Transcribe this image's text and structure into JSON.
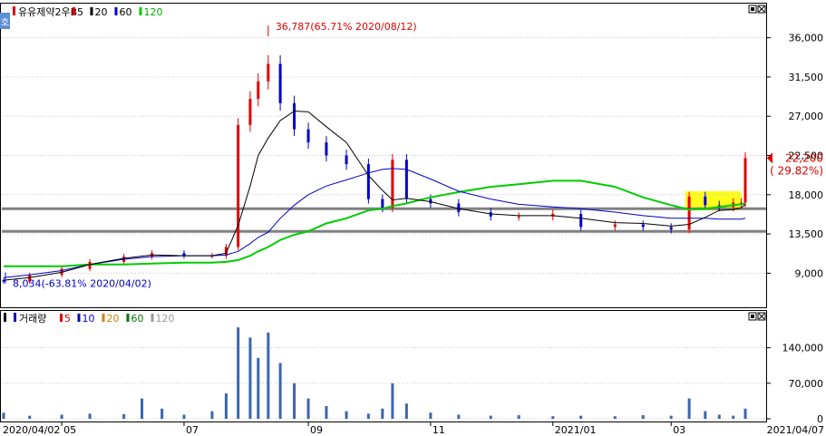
{
  "price_panel": {
    "legend_name": "유유제약2우B",
    "ma_labels": [
      "5",
      "20",
      "60",
      "120"
    ],
    "ma_colors": [
      "#e00000",
      "#000000",
      "#0000cc",
      "#00cc00"
    ],
    "side_tab": "호",
    "high_annotation": "36,787(65.71% 2020/08/12)",
    "low_annotation": "8,034(-63.81% 2020/04/02)",
    "last_price": "22,200",
    "last_change": "( 29.82%)"
  },
  "volume_panel": {
    "legend_name": "거래량",
    "ma_labels": [
      "5",
      "10",
      "20",
      "60",
      "120"
    ],
    "ma_colors": [
      "#e00000",
      "#0000cc",
      "#d08000",
      "#007700",
      "#999999"
    ]
  },
  "x_axis": {
    "start_label": "2020/04/02",
    "end_label": "2021/04/07",
    "ticks": [
      "05",
      "07",
      "09",
      "11",
      "2021/01",
      "03"
    ]
  },
  "colors": {
    "up": "#e00000",
    "down": "#0000cc",
    "highlight": "#ffff00",
    "support_line": "#808080"
  },
  "chart_data": [
    {
      "type": "line",
      "name": "price",
      "y_ticks": [
        9000,
        13500,
        18000,
        22500,
        27000,
        31500,
        36000
      ],
      "y_tick_labels": [
        "9,000",
        "13,500",
        "18,000",
        "22,500",
        "27,000",
        "31,500",
        "36,000"
      ],
      "ylim": [
        5400,
        39500
      ],
      "x": [
        "2020-04-02",
        "2020-04-15",
        "2020-05-01",
        "2020-05-15",
        "2020-06-01",
        "2020-06-15",
        "2020-07-01",
        "2020-07-15",
        "2020-07-22",
        "2020-07-28",
        "2020-08-03",
        "2020-08-07",
        "2020-08-12",
        "2020-08-18",
        "2020-08-25",
        "2020-09-01",
        "2020-09-10",
        "2020-09-20",
        "2020-10-01",
        "2020-10-08",
        "2020-10-13",
        "2020-10-20",
        "2020-11-01",
        "2020-11-15",
        "2020-12-01",
        "2020-12-15",
        "2021-01-01",
        "2021-01-15",
        "2021-02-01",
        "2021-02-15",
        "2021-03-01",
        "2021-03-10",
        "2021-03-18",
        "2021-03-25",
        "2021-04-01",
        "2021-04-05",
        "2021-04-07"
      ],
      "close": [
        8034,
        8800,
        9500,
        10300,
        10900,
        11300,
        11000,
        11000,
        12000,
        26000,
        29000,
        31000,
        33000,
        28500,
        25500,
        24000,
        22500,
        21500,
        17500,
        16500,
        22000,
        17500,
        17000,
        16000,
        15500,
        15500,
        15800,
        14300,
        14600,
        14300,
        14000,
        17800,
        16800,
        16600,
        17100,
        17100,
        22200
      ],
      "ma120": [
        9800,
        9800,
        9800,
        10000,
        10000,
        10100,
        10200,
        10200,
        10300,
        10500,
        11000,
        11500,
        12000,
        12800,
        13400,
        13800,
        14700,
        15300,
        16200,
        16400,
        16700,
        17000,
        17700,
        18300,
        18900,
        19200,
        19600,
        19600,
        18900,
        17700,
        16800,
        16300,
        16400,
        16600,
        16800,
        16900,
        17000
      ],
      "ma60": [
        8500,
        8800,
        9300,
        10000,
        10600,
        10900,
        11000,
        11000,
        11100,
        11500,
        12400,
        13100,
        13700,
        15300,
        16800,
        18000,
        19000,
        19700,
        20500,
        20900,
        21000,
        20900,
        19800,
        18400,
        17500,
        16900,
        16600,
        16400,
        16000,
        15600,
        15300,
        15300,
        15300,
        15200,
        15200,
        15200,
        15300
      ],
      "ma20": [
        8200,
        8500,
        9100,
        10000,
        10700,
        11100,
        11000,
        11000,
        11300,
        14500,
        19000,
        22500,
        24500,
        26500,
        27600,
        27500,
        25800,
        24000,
        20200,
        18500,
        17400,
        17600,
        17200,
        16400,
        15800,
        15600,
        15600,
        15300,
        14800,
        14700,
        14400,
        14600,
        15400,
        16200,
        16300,
        16500,
        16900
      ]
    },
    {
      "type": "bar",
      "name": "volume",
      "y_ticks": [
        0,
        70000,
        140000
      ],
      "y_tick_labels": [
        "0",
        "70,000",
        "140,000"
      ],
      "ylim": [
        0,
        200000
      ],
      "x": [
        "2020-04-02",
        "2020-04-15",
        "2020-05-01",
        "2020-05-15",
        "2020-06-01",
        "2020-06-10",
        "2020-06-20",
        "2020-07-01",
        "2020-07-15",
        "2020-07-22",
        "2020-07-28",
        "2020-08-03",
        "2020-08-07",
        "2020-08-12",
        "2020-08-18",
        "2020-08-25",
        "2020-09-01",
        "2020-09-10",
        "2020-09-20",
        "2020-10-01",
        "2020-10-08",
        "2020-10-13",
        "2020-10-20",
        "2020-11-01",
        "2020-11-15",
        "2020-12-01",
        "2020-12-15",
        "2021-01-01",
        "2021-01-15",
        "2021-02-01",
        "2021-02-15",
        "2021-03-01",
        "2021-03-10",
        "2021-03-18",
        "2021-03-25",
        "2021-04-01",
        "2021-04-07"
      ],
      "values": [
        12000,
        6000,
        8000,
        10000,
        9000,
        40000,
        20000,
        8000,
        15000,
        50000,
        180000,
        160000,
        120000,
        170000,
        110000,
        70000,
        40000,
        25000,
        15000,
        10000,
        20000,
        70000,
        30000,
        12000,
        8000,
        6000,
        7000,
        5000,
        6000,
        5000,
        7000,
        6000,
        40000,
        15000,
        8000,
        6000,
        20000
      ]
    }
  ]
}
